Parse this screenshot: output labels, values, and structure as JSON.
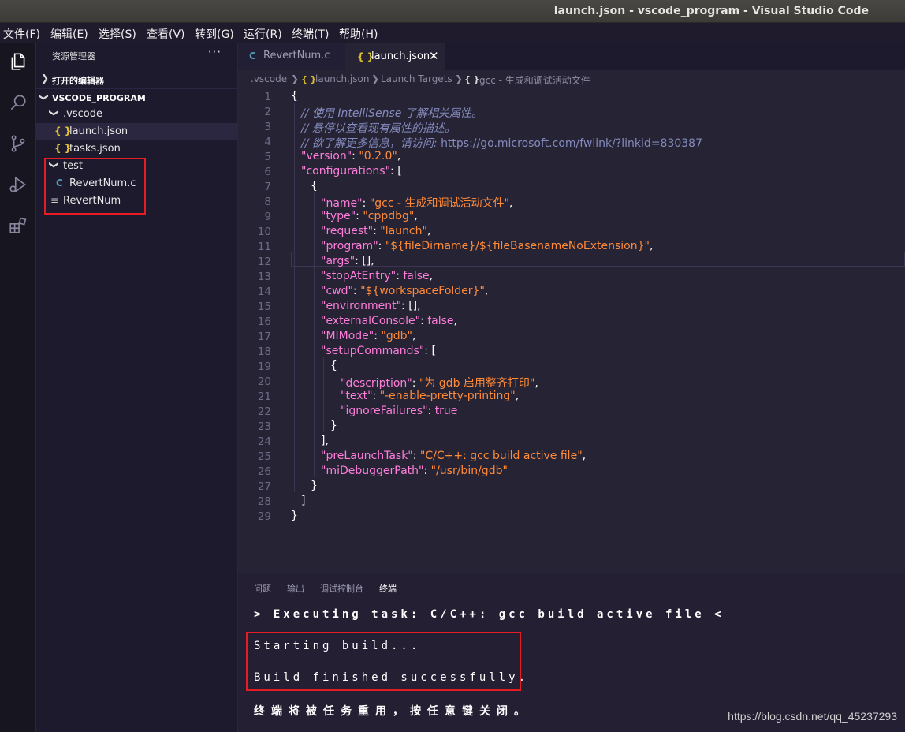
{
  "window": {
    "title": "launch.json - vscode_program - Visual Studio Code"
  },
  "menu": [
    "文件(F)",
    "编辑(E)",
    "选择(S)",
    "查看(V)",
    "转到(G)",
    "运行(R)",
    "终端(T)",
    "帮助(H)"
  ],
  "activity_icons": [
    "explorer-icon",
    "search-icon",
    "source-control-icon",
    "run-debug-icon",
    "extensions-icon"
  ],
  "sidebar": {
    "header": "资源管理器",
    "more": "···",
    "open_editors": "打开的编辑器",
    "project": "VSCODE_PROGRAM",
    "tree": [
      {
        "label": ".vscode",
        "type": "folder"
      },
      {
        "label": "launch.json",
        "type": "json"
      },
      {
        "label": "tasks.json",
        "type": "json"
      },
      {
        "label": "test",
        "type": "folder"
      },
      {
        "label": "RevertNum.c",
        "type": "c"
      },
      {
        "label": "RevertNum",
        "type": "file"
      }
    ]
  },
  "tabs": [
    {
      "label": "RevertNum.c",
      "icon": "C"
    },
    {
      "label": "launch.json",
      "icon": "{ }",
      "close": "✕"
    }
  ],
  "breadcrumbs": [
    ".vscode",
    "launch.json",
    "Launch Targets",
    "gcc - 生成和调试活动文件"
  ],
  "editor": {
    "line_numbers": [
      "1",
      "2",
      "3",
      "4",
      "5",
      "6",
      "7",
      "8",
      "9",
      "10",
      "11",
      "12",
      "13",
      "14",
      "15",
      "16",
      "17",
      "18",
      "19",
      "20",
      "21",
      "22",
      "23",
      "24",
      "25",
      "26",
      "27",
      "28",
      "29"
    ],
    "comments": {
      "c1": "// 使用 IntelliSense 了解相关属性。",
      "c2": "// 悬停以查看现有属性的描述。",
      "c3": "// 欲了解更多信息，请访问: ",
      "url": "https://go.microsoft.com/fwlink/?linkid=830387"
    },
    "k": {
      "version": "\"version\"",
      "configurations": "\"configurations\"",
      "name": "\"name\"",
      "type": "\"type\"",
      "request": "\"request\"",
      "program": "\"program\"",
      "args": "\"args\"",
      "stopAtEntry": "\"stopAtEntry\"",
      "cwd": "\"cwd\"",
      "environment": "\"environment\"",
      "externalConsole": "\"externalConsole\"",
      "MIMode": "\"MIMode\"",
      "setupCommands": "\"setupCommands\"",
      "description": "\"description\"",
      "text": "\"text\"",
      "ignoreFailures": "\"ignoreFailures\"",
      "preLaunchTask": "\"preLaunchTask\"",
      "miDebuggerPath": "\"miDebuggerPath\""
    },
    "v": {
      "version": "\"0.2.0\"",
      "name": "\"gcc - 生成和调试活动文件\"",
      "type": "\"cppdbg\"",
      "request": "\"launch\"",
      "program": "\"${fileDirname}/${fileBasenameNoExtension}\"",
      "stopAtEntry": "false",
      "cwd": "\"${workspaceFolder}\"",
      "externalConsole": "false",
      "MIMode": "\"gdb\"",
      "description": "\"为 gdb 启用整齐打印\"",
      "text": "\"-enable-pretty-printing\"",
      "ignoreFailures": "true",
      "preLaunchTask": "\"C/C++: gcc build active file\"",
      "miDebuggerPath": "\"/usr/bin/gdb\""
    }
  },
  "panel": {
    "tabs": [
      "问题",
      "输出",
      "调试控制台",
      "终端"
    ],
    "terminal_lines": [
      "> Executing task: C/C++: gcc build active file <",
      "Starting build...",
      "Build finished successfully.",
      "终端将被任务重用，按任意键关闭。"
    ],
    "watermark": "https://blog.csdn.net/qq_45237293"
  },
  "colors": {
    "accent": "#a148ab",
    "highlight_box": "#e51c23",
    "background": "#262335"
  }
}
